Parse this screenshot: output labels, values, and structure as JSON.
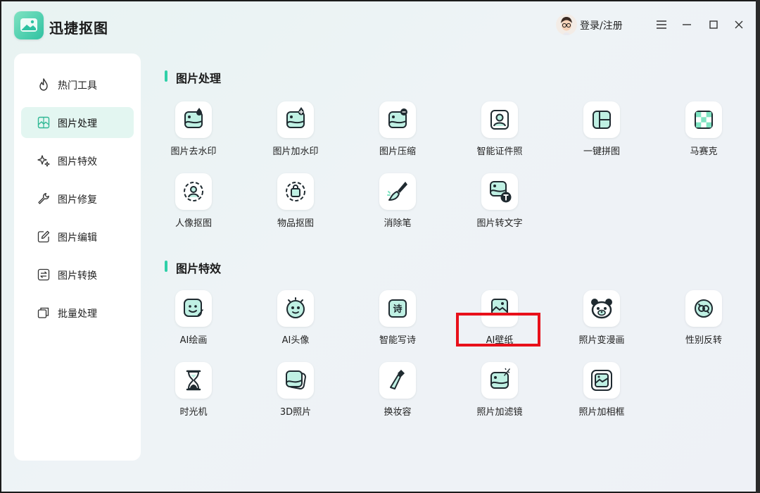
{
  "app": {
    "title": "迅捷抠图",
    "login_label": "登录/注册"
  },
  "window_controls": [
    "menu-icon",
    "minimize-icon",
    "maximize-icon",
    "close-icon"
  ],
  "colors": {
    "accent": "#2fd0a8",
    "active_bg": "#e3f6f1",
    "highlight": "#e8101a",
    "icon_dark": "#1f2a30"
  },
  "sidebar": {
    "items": [
      {
        "label": "热门工具",
        "icon": "flame-icon"
      },
      {
        "label": "图片处理",
        "icon": "image-process-icon",
        "active": true
      },
      {
        "label": "图片特效",
        "icon": "sparkle-icon"
      },
      {
        "label": "图片修复",
        "icon": "wrench-icon"
      },
      {
        "label": "图片编辑",
        "icon": "edit-icon"
      },
      {
        "label": "图片转换",
        "icon": "convert-icon"
      },
      {
        "label": "批量处理",
        "icon": "batch-icon"
      }
    ]
  },
  "sections": [
    {
      "title": "图片处理",
      "tools": [
        {
          "label": "图片去水印",
          "icon": "remove-watermark-icon"
        },
        {
          "label": "图片加水印",
          "icon": "add-watermark-icon"
        },
        {
          "label": "图片压缩",
          "icon": "compress-icon"
        },
        {
          "label": "智能证件照",
          "icon": "id-photo-icon"
        },
        {
          "label": "一键拼图",
          "icon": "collage-icon"
        },
        {
          "label": "马赛克",
          "icon": "mosaic-icon"
        },
        {
          "label": "人像抠图",
          "icon": "portrait-cutout-icon"
        },
        {
          "label": "物品抠图",
          "icon": "object-cutout-icon"
        },
        {
          "label": "消除笔",
          "icon": "eraser-brush-icon"
        },
        {
          "label": "图片转文字",
          "icon": "image-to-text-icon"
        }
      ]
    },
    {
      "title": "图片特效",
      "tools": [
        {
          "label": "AI绘画",
          "icon": "ai-paint-icon"
        },
        {
          "label": "AI头像",
          "icon": "ai-avatar-icon"
        },
        {
          "label": "智能写诗",
          "icon": "poem-icon",
          "glyph": "诗"
        },
        {
          "label": "AI壁纸",
          "icon": "wallpaper-icon",
          "highlighted": true
        },
        {
          "label": "照片变漫画",
          "icon": "cartoon-icon"
        },
        {
          "label": "性别反转",
          "icon": "gender-swap-icon"
        },
        {
          "label": "时光机",
          "icon": "hourglass-icon"
        },
        {
          "label": "3D照片",
          "icon": "3d-photo-icon"
        },
        {
          "label": "换妆容",
          "icon": "makeup-icon"
        },
        {
          "label": "照片加滤镜",
          "icon": "filter-icon"
        },
        {
          "label": "照片加相框",
          "icon": "frame-icon"
        }
      ]
    }
  ]
}
